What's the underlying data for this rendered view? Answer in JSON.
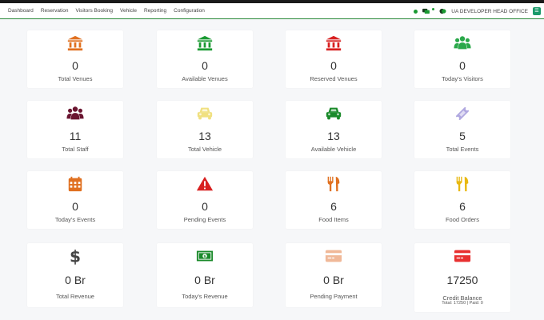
{
  "nav": {
    "links": [
      "Dashboard",
      "Reservation",
      "Visitors Booking",
      "Vehicle",
      "Reporting",
      "Configuration"
    ],
    "user": "UA DEVELOPER HEAD OFFICE"
  },
  "cards": [
    {
      "value": "0",
      "label": "Total Venues",
      "icon": "bank-icon",
      "color": "#e07020"
    },
    {
      "value": "0",
      "label": "Available Venues",
      "icon": "bank-icon",
      "color": "#1a9a32"
    },
    {
      "value": "0",
      "label": "Reserved Venues",
      "icon": "bank-icon",
      "color": "#d82020"
    },
    {
      "value": "0",
      "label": "Today's Visitors",
      "icon": "users-icon",
      "color": "#2aa84a"
    },
    {
      "value": "11",
      "label": "Total Staff",
      "icon": "users-icon",
      "color": "#6a1530"
    },
    {
      "value": "13",
      "label": "Total Vehicle",
      "icon": "car-icon",
      "color": "#f0e080"
    },
    {
      "value": "13",
      "label": "Available Vehicle",
      "icon": "car-icon",
      "color": "#1a8a2a"
    },
    {
      "value": "5",
      "label": "Total Events",
      "icon": "ticket-icon",
      "color": "#b0a8e0"
    },
    {
      "value": "0",
      "label": "Today's Events",
      "icon": "calendar-icon",
      "color": "#e07020"
    },
    {
      "value": "0",
      "label": "Pending Events",
      "icon": "warning-icon",
      "color": "#d82020"
    },
    {
      "value": "6",
      "label": "Food Items",
      "icon": "cutlery-icon",
      "color": "#e07020"
    },
    {
      "value": "6",
      "label": "Food Orders",
      "icon": "cutlery-icon",
      "color": "#e8b810"
    },
    {
      "value": "0 Br",
      "label": "Total Revenue",
      "icon": "dollar-icon",
      "color": "#444444"
    },
    {
      "value": "0 Br",
      "label": "Today's Revenue",
      "icon": "money-icon",
      "color": "#1a8a2a"
    },
    {
      "value": "0 Br",
      "label": "Pending Payment",
      "icon": "credit-card-icon",
      "color": "#f0b898"
    },
    {
      "value": "17250",
      "label": "Credit Balance",
      "icon": "credit-card-icon",
      "color": "#e83030",
      "sub": "Total: 17250 | Paid: 0"
    }
  ]
}
